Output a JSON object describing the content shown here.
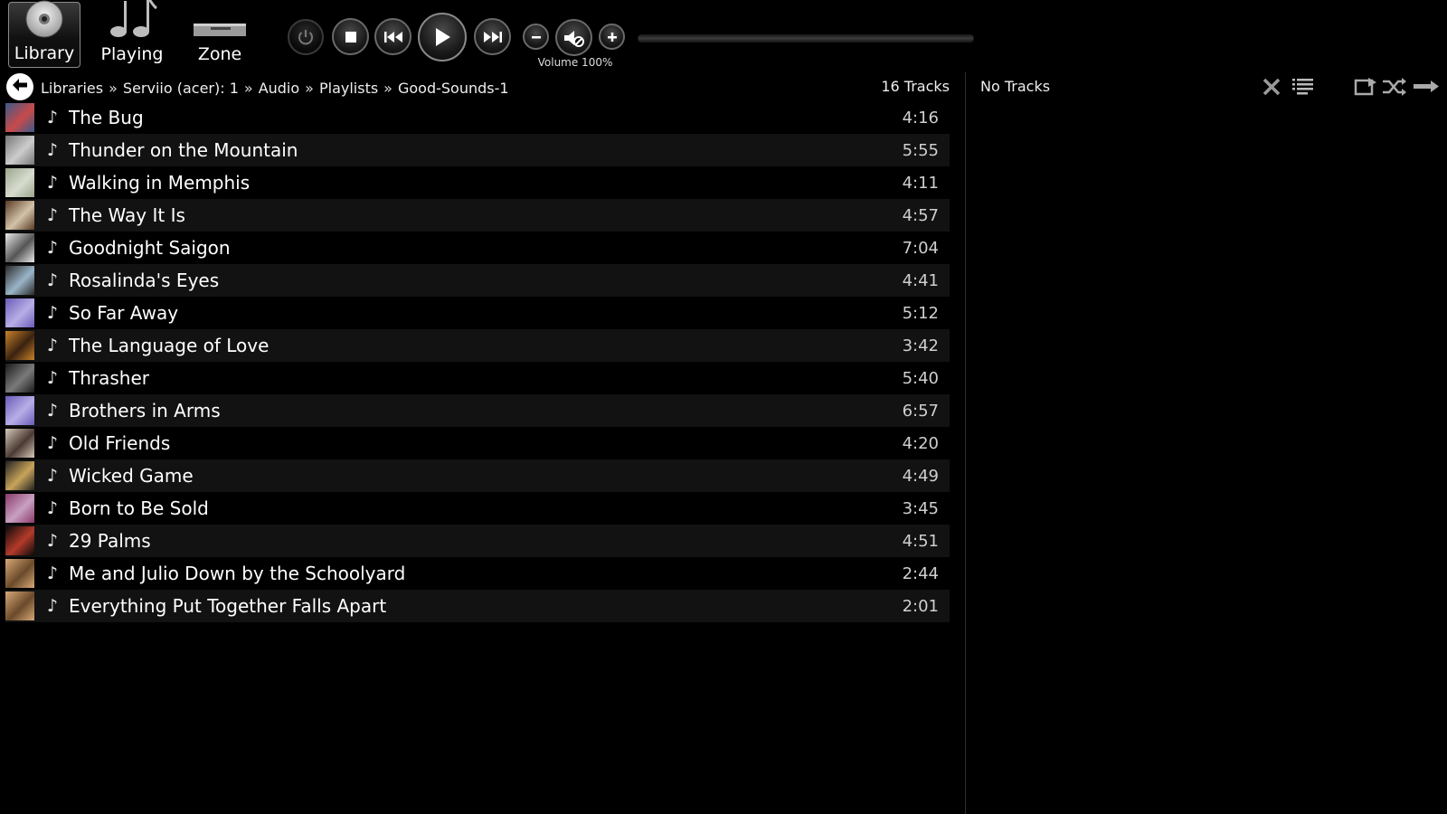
{
  "nav": {
    "library": "Library",
    "playing": "Playing",
    "zone": "Zone"
  },
  "transport": {
    "volume_label": "Volume 100%"
  },
  "breadcrumb": {
    "items": [
      "Libraries",
      "Serviio (acer): 1",
      "Audio",
      "Playlists",
      "Good-Sounds-1"
    ],
    "separator": "»"
  },
  "track_count": "16 Tracks",
  "tracks": [
    {
      "title": "The Bug",
      "duration": "4:16",
      "art": [
        "#3a5a8a",
        "#c94a4a"
      ]
    },
    {
      "title": "Thunder on the Mountain",
      "duration": "5:55",
      "art": [
        "#777777",
        "#cccccc"
      ]
    },
    {
      "title": "Walking in Memphis",
      "duration": "4:11",
      "art": [
        "#9aa58a",
        "#d8dccf"
      ]
    },
    {
      "title": "The Way It Is",
      "duration": "4:57",
      "art": [
        "#5a3a24",
        "#d2c3a8"
      ]
    },
    {
      "title": "Goodnight Saigon",
      "duration": "7:04",
      "art": [
        "#e9e9e9",
        "#555555"
      ]
    },
    {
      "title": "Rosalinda's Eyes",
      "duration": "4:41",
      "art": [
        "#2a2a2a",
        "#9ab5c8"
      ]
    },
    {
      "title": "So Far Away",
      "duration": "5:12",
      "art": [
        "#6a5bb8",
        "#b8aee6"
      ]
    },
    {
      "title": "The Language of Love",
      "duration": "3:42",
      "art": [
        "#c9822a",
        "#3a2210"
      ]
    },
    {
      "title": "Thrasher",
      "duration": "5:40",
      "art": [
        "#1a1a1a",
        "#7a7a7a"
      ]
    },
    {
      "title": "Brothers in Arms",
      "duration": "6:57",
      "art": [
        "#6a5bb8",
        "#b8aee6"
      ]
    },
    {
      "title": "Old Friends",
      "duration": "4:20",
      "art": [
        "#d6c8b8",
        "#4a3a34"
      ]
    },
    {
      "title": "Wicked Game",
      "duration": "4:49",
      "art": [
        "#222222",
        "#c8a45a"
      ]
    },
    {
      "title": "Born to Be Sold",
      "duration": "3:45",
      "art": [
        "#8a3a6a",
        "#c8a0c0"
      ]
    },
    {
      "title": "29 Palms",
      "duration": "4:51",
      "art": [
        "#0a0a0a",
        "#b43a2a"
      ]
    },
    {
      "title": "Me and Julio Down by the Schoolyard",
      "duration": "2:44",
      "art": [
        "#d8a878",
        "#6a4a2a"
      ]
    },
    {
      "title": "Everything Put Together Falls Apart",
      "duration": "2:01",
      "art": [
        "#d8a878",
        "#6a4a2a"
      ]
    }
  ],
  "queue": {
    "label": "No Tracks"
  },
  "icons": {
    "library": "disc-icon",
    "playing": "music-notes-icon",
    "zone": "player-device-icon",
    "power": "power-icon",
    "stop": "stop-icon",
    "prev": "previous-icon",
    "play": "play-icon",
    "next": "next-icon",
    "vol_down": "minus-icon",
    "mute": "mute-icon",
    "vol_up": "plus-icon",
    "back": "back-arrow-icon",
    "note": "music-note-icon",
    "clear": "clear-icon",
    "queue_menu": "list-icon",
    "save": "save-playlist-icon",
    "shuffle": "shuffle-icon",
    "repeat": "repeat-icon"
  }
}
